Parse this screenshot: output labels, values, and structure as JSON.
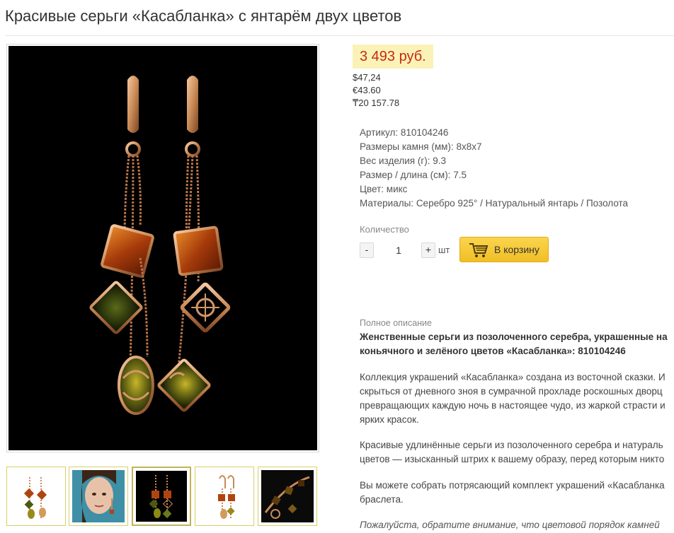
{
  "product": {
    "title": "Красивые серьги «Касабланка» с янтарём двух цветов"
  },
  "price": {
    "main": "3 493 руб.",
    "usd": "$47,24",
    "eur": "€43.60",
    "kzt": "₸20 157.78"
  },
  "specs": [
    {
      "key": "Артикул:",
      "value": "810104246"
    },
    {
      "key": "Размеры камня (мм):",
      "value": "8x8x7"
    },
    {
      "key": "Вес изделия (г):",
      "value": "9.3"
    },
    {
      "key": "Размер / длина (см):",
      "value": "7.5"
    },
    {
      "key": "Цвет:",
      "value": "микс"
    },
    {
      "key": "Материалы:",
      "value": "Серебро 925° / Натуральный янтарь / Позолота"
    }
  ],
  "quantity": {
    "label": "Количество",
    "minus": "-",
    "value": "1",
    "plus": "+",
    "unit": "шт"
  },
  "cart": {
    "label": "В корзину",
    "icon": "cart-icon"
  },
  "description": {
    "label": "Полное описание",
    "bold_lines": [
      "Женственные серьги из позолоченного серебра, украшенные на",
      "коньячного и зелёного цветов «Касабланка»: 810104246"
    ],
    "para1": [
      "Коллекция украшений «Касабланка» создана из восточной сказки. И",
      "скрыться от дневного зноя в сумрачной прохладе роскошных дворц",
      "превращающих каждую ночь в настоящее чудо, из жаркой страсти и",
      "ярких красок."
    ],
    "para2": [
      "Красивые удлинённые серьги из позолоченного серебра и натураль",
      "цветов — изысканный штрих к вашему образу, перед которым никто"
    ],
    "para3": [
      "Вы можете собрать потрясающий комплект украшений «Касабланка",
      "браслета."
    ],
    "note": "Пожалуйста, обратите внимание, что цветовой порядок камней"
  },
  "gallery": {
    "active_index": 2,
    "thumbnails": [
      "earrings-front",
      "model-portrait",
      "earrings-dark",
      "earrings-light",
      "jewelry-set"
    ]
  },
  "colors": {
    "price_text": "#c62a10",
    "price_bg": "#fbf2b7",
    "cart_button": "#f5c531",
    "gold": "#c98a56",
    "amber_cognac": "#b0440f",
    "amber_green": "#4a5a12"
  }
}
